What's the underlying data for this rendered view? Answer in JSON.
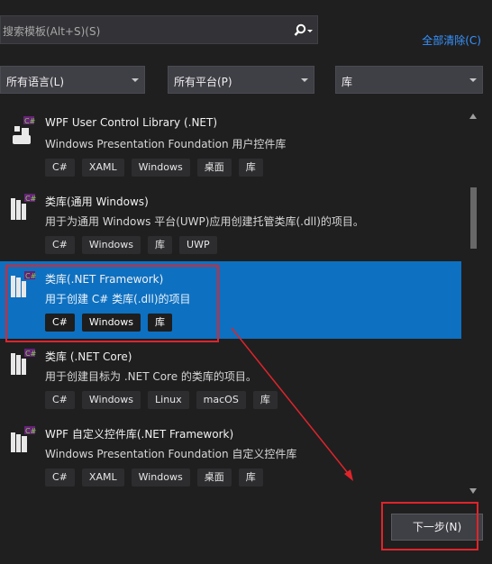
{
  "search": {
    "placeholder": "搜索模板(Alt+S)(S)",
    "icon": "search-icon"
  },
  "clear_all_label": "全部清除(C)",
  "filters": {
    "language": "所有语言(L)",
    "platform": "所有平台(P)",
    "project_type": "库"
  },
  "templates": [
    {
      "title": "WPF User Control Library (.NET)",
      "description": "Windows Presentation Foundation 用户控件库",
      "tags": [
        "C#",
        "XAML",
        "Windows",
        "桌面",
        "库"
      ],
      "selected": false
    },
    {
      "title": "类库(通用 Windows)",
      "description": "用于为通用 Windows 平台(UWP)应用创建托管类库(.dll)的项目。",
      "tags": [
        "C#",
        "Windows",
        "库",
        "UWP"
      ],
      "selected": false
    },
    {
      "title": "类库(.NET Framework)",
      "description": "用于创建 C# 类库(.dll)的项目",
      "tags": [
        "C#",
        "Windows",
        "库"
      ],
      "selected": true
    },
    {
      "title": "类库 (.NET Core)",
      "description": "用于创建目标为 .NET Core 的类库的项目。",
      "tags": [
        "C#",
        "Windows",
        "Linux",
        "macOS",
        "库"
      ],
      "selected": false
    },
    {
      "title": "WPF 自定义控件库(.NET Framework)",
      "description": "Windows Presentation Foundation 自定义控件库",
      "tags": [
        "C#",
        "XAML",
        "Windows",
        "桌面",
        "库"
      ],
      "selected": false
    }
  ],
  "next_button_label": "下一步(N)",
  "colors": {
    "accent": "#0e70c0",
    "annotation_red": "#e0242a",
    "link": "#3794ff"
  }
}
